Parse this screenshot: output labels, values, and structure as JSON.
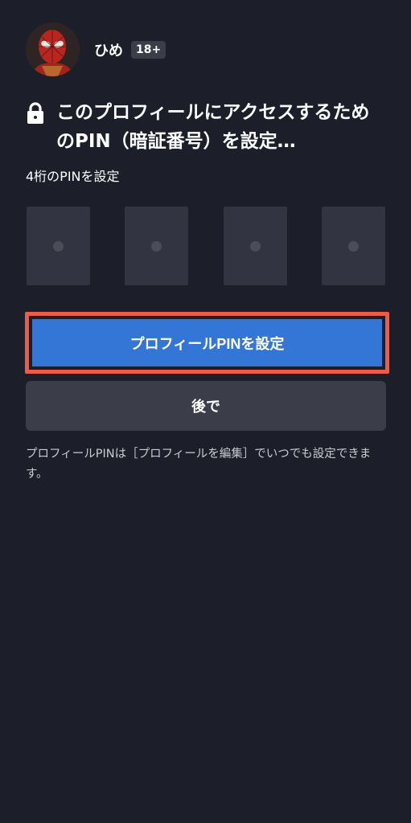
{
  "profile": {
    "name": "ひめ",
    "badge": "18+"
  },
  "title": "このプロフィールにアクセスするためのPIN（暗証番号）を設定…",
  "pin_label": "4桁のPINを設定",
  "pin_boxes": [
    "•",
    "•",
    "•",
    "•"
  ],
  "buttons": {
    "primary": "プロフィールPINを設定",
    "secondary": "後で"
  },
  "footnote": "プロフィールPINは［プロフィールを編集］でいつでも設定できます。",
  "colors": {
    "background": "#1c1f2a",
    "primary_button": "#3476d6",
    "secondary_button": "#3b3e49",
    "pin_box": "#323541",
    "highlight_border": "#ef5b45"
  },
  "icons": {
    "title_icon": "lock-icon",
    "avatar": "spider-hero-avatar"
  }
}
